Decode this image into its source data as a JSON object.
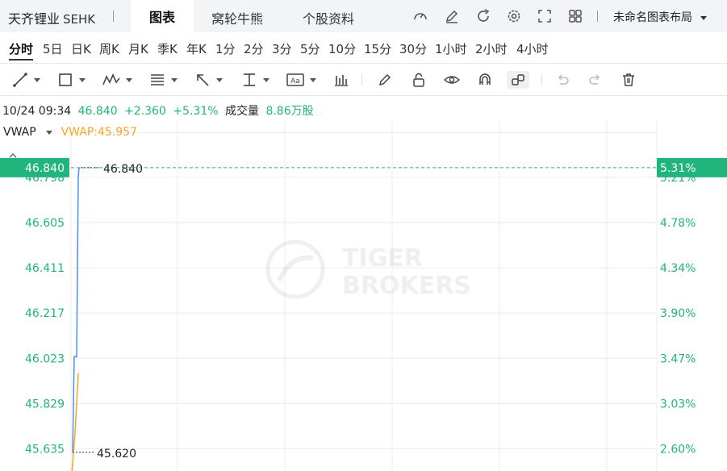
{
  "header": {
    "stock_name": "天齐锂业",
    "exchange": "SEHK",
    "tabs": [
      "图表",
      "窝轮牛熊",
      "个股资料"
    ],
    "active_tab": "图表",
    "layout_label": "未命名图表布局"
  },
  "periods": [
    "分时",
    "5日",
    "日K",
    "周K",
    "月K",
    "季K",
    "年K",
    "1分",
    "2分",
    "3分",
    "5分",
    "10分",
    "15分",
    "30分",
    "1小时",
    "2小时",
    "4小时"
  ],
  "active_period": "分时",
  "toolbar_icons": [
    "line-tool-icon",
    "rectangle-tool-icon",
    "pattern-tool-icon",
    "fibonacci-tool-icon",
    "arrow-tool-icon",
    "measure-tool-icon",
    "text-tool-icon",
    "indicator-tool-icon",
    "brush-icon",
    "lock-icon",
    "eye-icon",
    "magnet-icon",
    "link-icon",
    "undo-icon",
    "redo-icon",
    "delete-icon"
  ],
  "quote": {
    "datetime": "10/24 09:34",
    "price": "46.840",
    "change": "+2.360",
    "change_pct": "+5.31%",
    "volume_label": "成交量",
    "volume": "8.86万股"
  },
  "indicator": {
    "name": "VWAP",
    "value_text": "VWAP:45.957",
    "collapse_symbol": "^"
  },
  "watermark": [
    "TIGER",
    "BROKERS"
  ],
  "colors": {
    "up": "#21b47d",
    "price_line": "#4c8df6",
    "vwap": "#f5a623",
    "current_badge": "#21b47d"
  },
  "chart_data": {
    "type": "line",
    "ylim": [
      45.54,
      47.04
    ],
    "y_ticks": [
      "46.798",
      "46.605",
      "46.411",
      "46.217",
      "46.023",
      "45.829",
      "45.635"
    ],
    "y_tick_values": [
      46.798,
      46.605,
      46.411,
      46.217,
      46.023,
      45.829,
      45.635
    ],
    "pct_ticks": [
      "5.21%",
      "4.78%",
      "4.34%",
      "3.90%",
      "3.47%",
      "3.03%",
      "2.60%"
    ],
    "current_price": 46.84,
    "current_label": "46.840",
    "current_pct_label": "5.31%",
    "high_label": "46.840",
    "low_label": "45.620",
    "low_value": 45.62,
    "series": [
      {
        "name": "Price",
        "color": "#4c8df6",
        "x": [
          0,
          1,
          2,
          3,
          4
        ],
        "values": [
          45.62,
          46.03,
          46.03,
          46.8,
          46.84
        ]
      },
      {
        "name": "VWAP",
        "color": "#f5a623",
        "x": [
          0,
          1,
          2
        ],
        "values": [
          45.53,
          45.7,
          45.96
        ]
      }
    ]
  }
}
